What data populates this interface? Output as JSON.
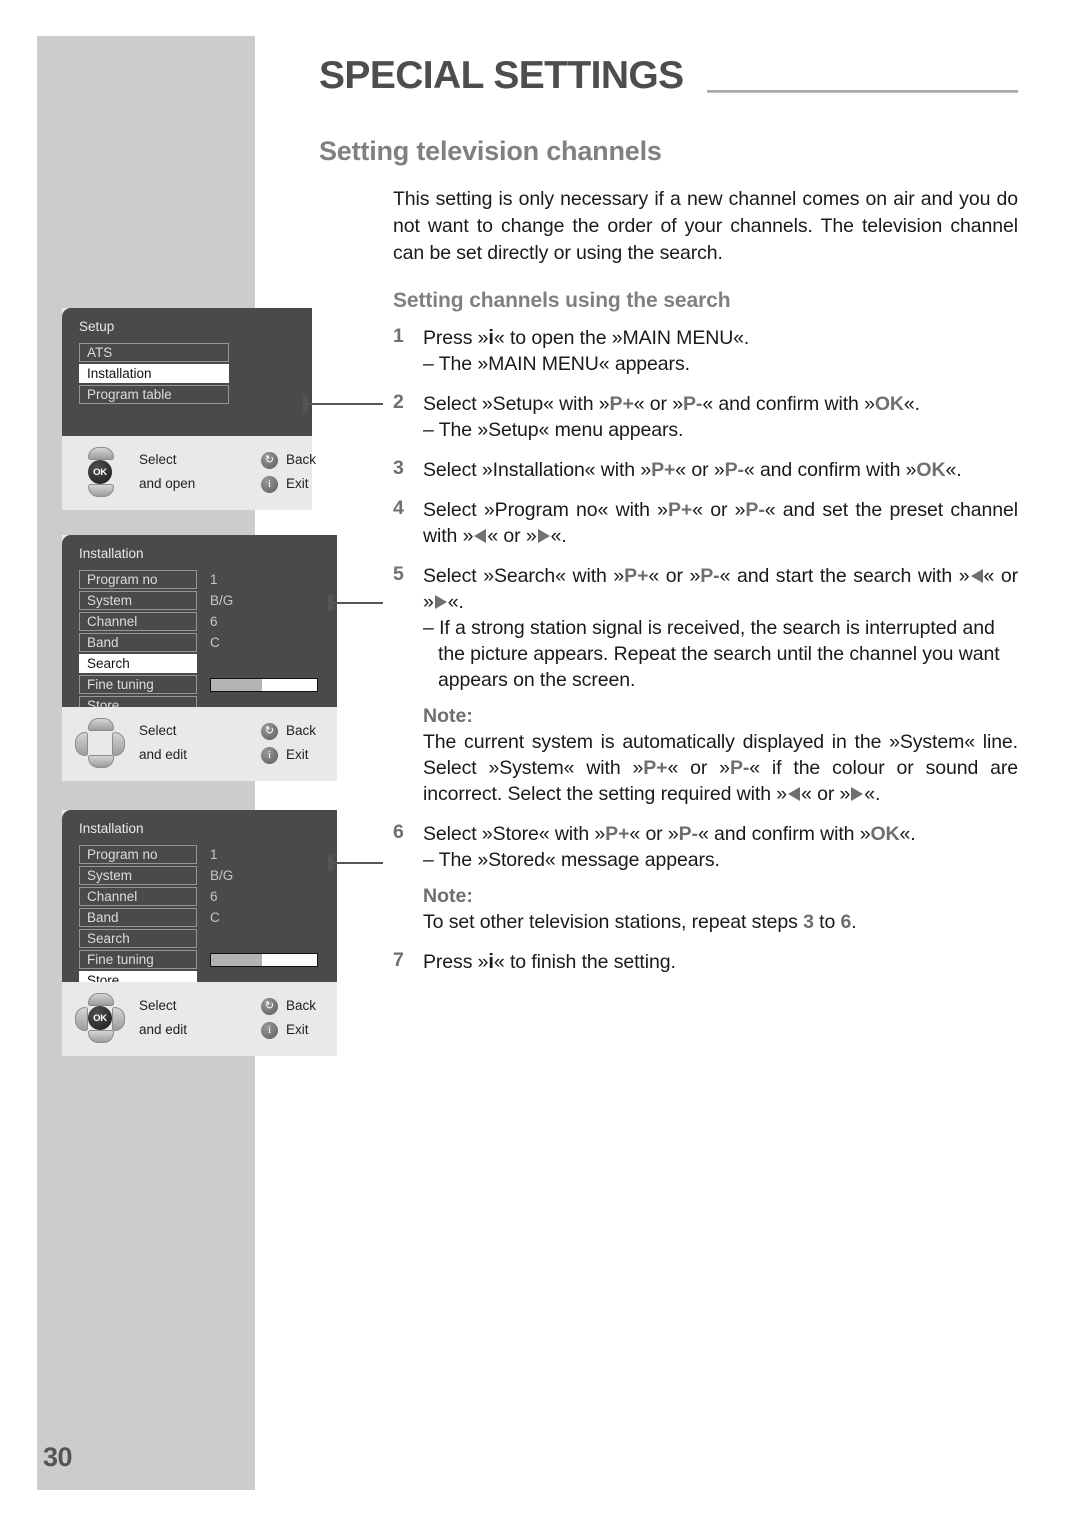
{
  "page": {
    "number": "30",
    "chapter_title": "SPECIAL SETTINGS",
    "section_title": "Setting television channels"
  },
  "content": {
    "intro": "This setting is only necessary if a new channel comes on air and you do not want to change the order of your channels. The television channel can be set directly or using the search.",
    "subsection_title": "Setting channels using the search",
    "steps": [
      {
        "num": "1",
        "body_html": "Press »<span class=\"key-i\">i</span>« to open the »MAIN MENU«.",
        "subs": [
          "– The »MAIN MENU« appears."
        ]
      },
      {
        "num": "2",
        "body_html": "Select »Setup« with »<span class=\"key\">P+</span>« or »<span class=\"key\">P-</span>« and confirm with »<span class=\"key\">OK</span>«.",
        "subs": [
          "– The »Setup« menu appears."
        ]
      },
      {
        "num": "3",
        "body_html": "Select »Installation« with »<span class=\"key\">P+</span>« or »<span class=\"key\">P-</span>« and confirm with »<span class=\"key\">OK</span>«.",
        "subs": []
      },
      {
        "num": "4",
        "body_html": "Select »Program no« with »<span class=\"key\">P+</span>« or »<span class=\"key\">P-</span>« and set the preset channel with »<span class=\"tri tri-left\"></span>« or »<span class=\"tri tri-right\"></span>«.",
        "subs": []
      },
      {
        "num": "5",
        "body_html": "Select »Search« with »<span class=\"key\">P+</span>« or »<span class=\"key\">P-</span>« and start the search with »<span class=\"tri tri-left\"></span>« or »<span class=\"tri tri-right\"></span>«.",
        "subs": [
          "– If a strong station signal is received, the search is interrupted and the picture appears. Repeat the search until the channel you want appears on the screen."
        ]
      },
      {
        "num": "6",
        "body_html": "Select »Store« with »<span class=\"key\">P+</span>« or »<span class=\"key\">P-</span>« and confirm with »<span class=\"key\">OK</span>«.",
        "subs": [
          "– The »Stored« message appears."
        ]
      },
      {
        "num": "7",
        "body_html": "Press »<span class=\"key-i\">i</span>« to finish the setting.",
        "subs": []
      }
    ],
    "note_1": {
      "label": "Note:",
      "text_html": "The current system is automatically displayed in the »System« line. Select »System« with »<span class=\"key\">P+</span>« or »<span class=\"key\">P-</span>« if the colour or sound are incorrect. Select the setting required with »<span class=\"tri tri-left\"></span>« or »<span class=\"tri tri-right\"></span>«."
    },
    "note_2": {
      "label": "Note:",
      "text_html": "To set other television stations, repeat steps <span class=\"key\">3</span> to <span class=\"key\">6</span>."
    }
  },
  "osd_menus": [
    {
      "title": "Setup",
      "rows": [
        {
          "label": "ATS",
          "value": "",
          "selected": false,
          "bar": false
        },
        {
          "label": "Installation",
          "value": "",
          "selected": true,
          "bar": false
        },
        {
          "label": "Program table",
          "value": "",
          "selected": false,
          "bar": false
        }
      ],
      "footer": {
        "select_label": "Select",
        "action_label": "and open",
        "back_label": "Back",
        "exit_label": "Exit",
        "back_icon": "↻",
        "exit_icon": "i",
        "ok_label": "OK",
        "pad_style": "updown-ok"
      }
    },
    {
      "title": "Installation",
      "rows": [
        {
          "label": "Program no",
          "value": "1",
          "selected": false,
          "bar": false
        },
        {
          "label": "System",
          "value": "B/G",
          "selected": false,
          "bar": false
        },
        {
          "label": "Channel",
          "value": "6",
          "selected": false,
          "bar": false
        },
        {
          "label": "Band",
          "value": "C",
          "selected": false,
          "bar": false
        },
        {
          "label": "Search",
          "value": "",
          "selected": true,
          "bar": false
        },
        {
          "label": "Fine tuning",
          "value": "",
          "selected": false,
          "bar": true,
          "bar_fill_pct": 48
        },
        {
          "label": "Store",
          "value": "",
          "selected": false,
          "bar": false
        }
      ],
      "footer": {
        "select_label": "Select",
        "action_label": "and edit",
        "back_label": "Back",
        "exit_label": "Exit",
        "back_icon": "↻",
        "exit_icon": "i",
        "ok_label": "",
        "pad_style": "fourway"
      }
    },
    {
      "title": "Installation",
      "rows": [
        {
          "label": "Program no",
          "value": "1",
          "selected": false,
          "bar": false
        },
        {
          "label": "System",
          "value": "B/G",
          "selected": false,
          "bar": false
        },
        {
          "label": "Channel",
          "value": "6",
          "selected": false,
          "bar": false
        },
        {
          "label": "Band",
          "value": "C",
          "selected": false,
          "bar": false
        },
        {
          "label": "Search",
          "value": "",
          "selected": false,
          "bar": false
        },
        {
          "label": "Fine tuning",
          "value": "",
          "selected": false,
          "bar": true,
          "bar_fill_pct": 48
        },
        {
          "label": "Store",
          "value": "",
          "selected": true,
          "bar": false
        }
      ],
      "footer": {
        "select_label": "Select",
        "action_label": "and edit",
        "back_label": "Back",
        "exit_label": "Exit",
        "back_icon": "↻",
        "exit_icon": "i",
        "ok_label": "OK",
        "pad_style": "fourway-ok"
      }
    }
  ],
  "colors": {
    "sidebar_band": "#cccccc",
    "heading_gray": "#808080",
    "chapter_gray": "#4d4d4d",
    "osd_screen": "#4a4a4a",
    "osd_footer": "#e9e9e9",
    "osd_border": "#8d9c8d",
    "key_gray": "#6f6f6f"
  }
}
